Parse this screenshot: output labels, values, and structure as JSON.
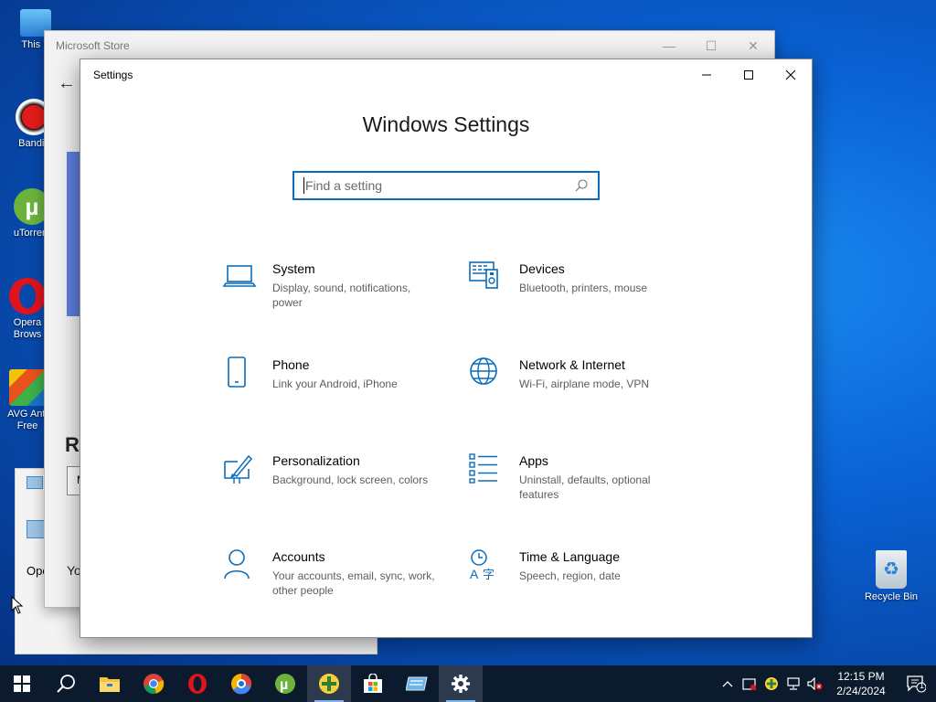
{
  "desktop": {
    "icons": [
      {
        "label": "This P",
        "icon": "this-pc-icon"
      },
      {
        "label": "Bandic",
        "icon": "bandicam-icon"
      },
      {
        "label": "uTorrent",
        "icon": "utorrent-icon"
      },
      {
        "label": "Opera Brows",
        "icon": "opera-icon"
      },
      {
        "label": "AVG Anti Free",
        "icon": "avg-icon"
      },
      {
        "label": "Recycle Bin",
        "icon": "recycle-bin-icon"
      }
    ],
    "frag_label": "Ope"
  },
  "store": {
    "title": "Microsoft Store",
    "heading_fragment": "Ra",
    "box_fragment": "M",
    "text_fragment": "Yo"
  },
  "settings": {
    "title": "Settings",
    "heading": "Windows Settings",
    "search_placeholder": "Find a setting",
    "tiles": [
      {
        "name": "System",
        "desc": "Display, sound, notifications, power",
        "icon": "laptop-icon"
      },
      {
        "name": "Devices",
        "desc": "Bluetooth, printers, mouse",
        "icon": "devices-icon"
      },
      {
        "name": "Phone",
        "desc": "Link your Android, iPhone",
        "icon": "phone-icon"
      },
      {
        "name": "Network & Internet",
        "desc": "Wi-Fi, airplane mode, VPN",
        "icon": "globe-icon"
      },
      {
        "name": "Personalization",
        "desc": "Background, lock screen, colors",
        "icon": "paint-icon"
      },
      {
        "name": "Apps",
        "desc": "Uninstall, defaults, optional features",
        "icon": "apps-list-icon"
      },
      {
        "name": "Accounts",
        "desc": "Your accounts, email, sync, work, other people",
        "icon": "person-icon"
      },
      {
        "name": "Time & Language",
        "desc": "Speech, region, date",
        "icon": "time-language-icon"
      }
    ]
  },
  "taskbar": {
    "apps": [
      "start-icon",
      "search-icon",
      "file-explorer-icon",
      "chrome-icon",
      "opera-icon",
      "comodo-icon",
      "utorrent-icon",
      "green-app-icon",
      "store-icon",
      "window-app-icon",
      "settings-icon"
    ],
    "time": "12:15 PM",
    "date": "2/24/2024",
    "notification_count": "1"
  },
  "colors": {
    "accent": "#0a6cbd",
    "taskbar": "#0c1a2d"
  }
}
